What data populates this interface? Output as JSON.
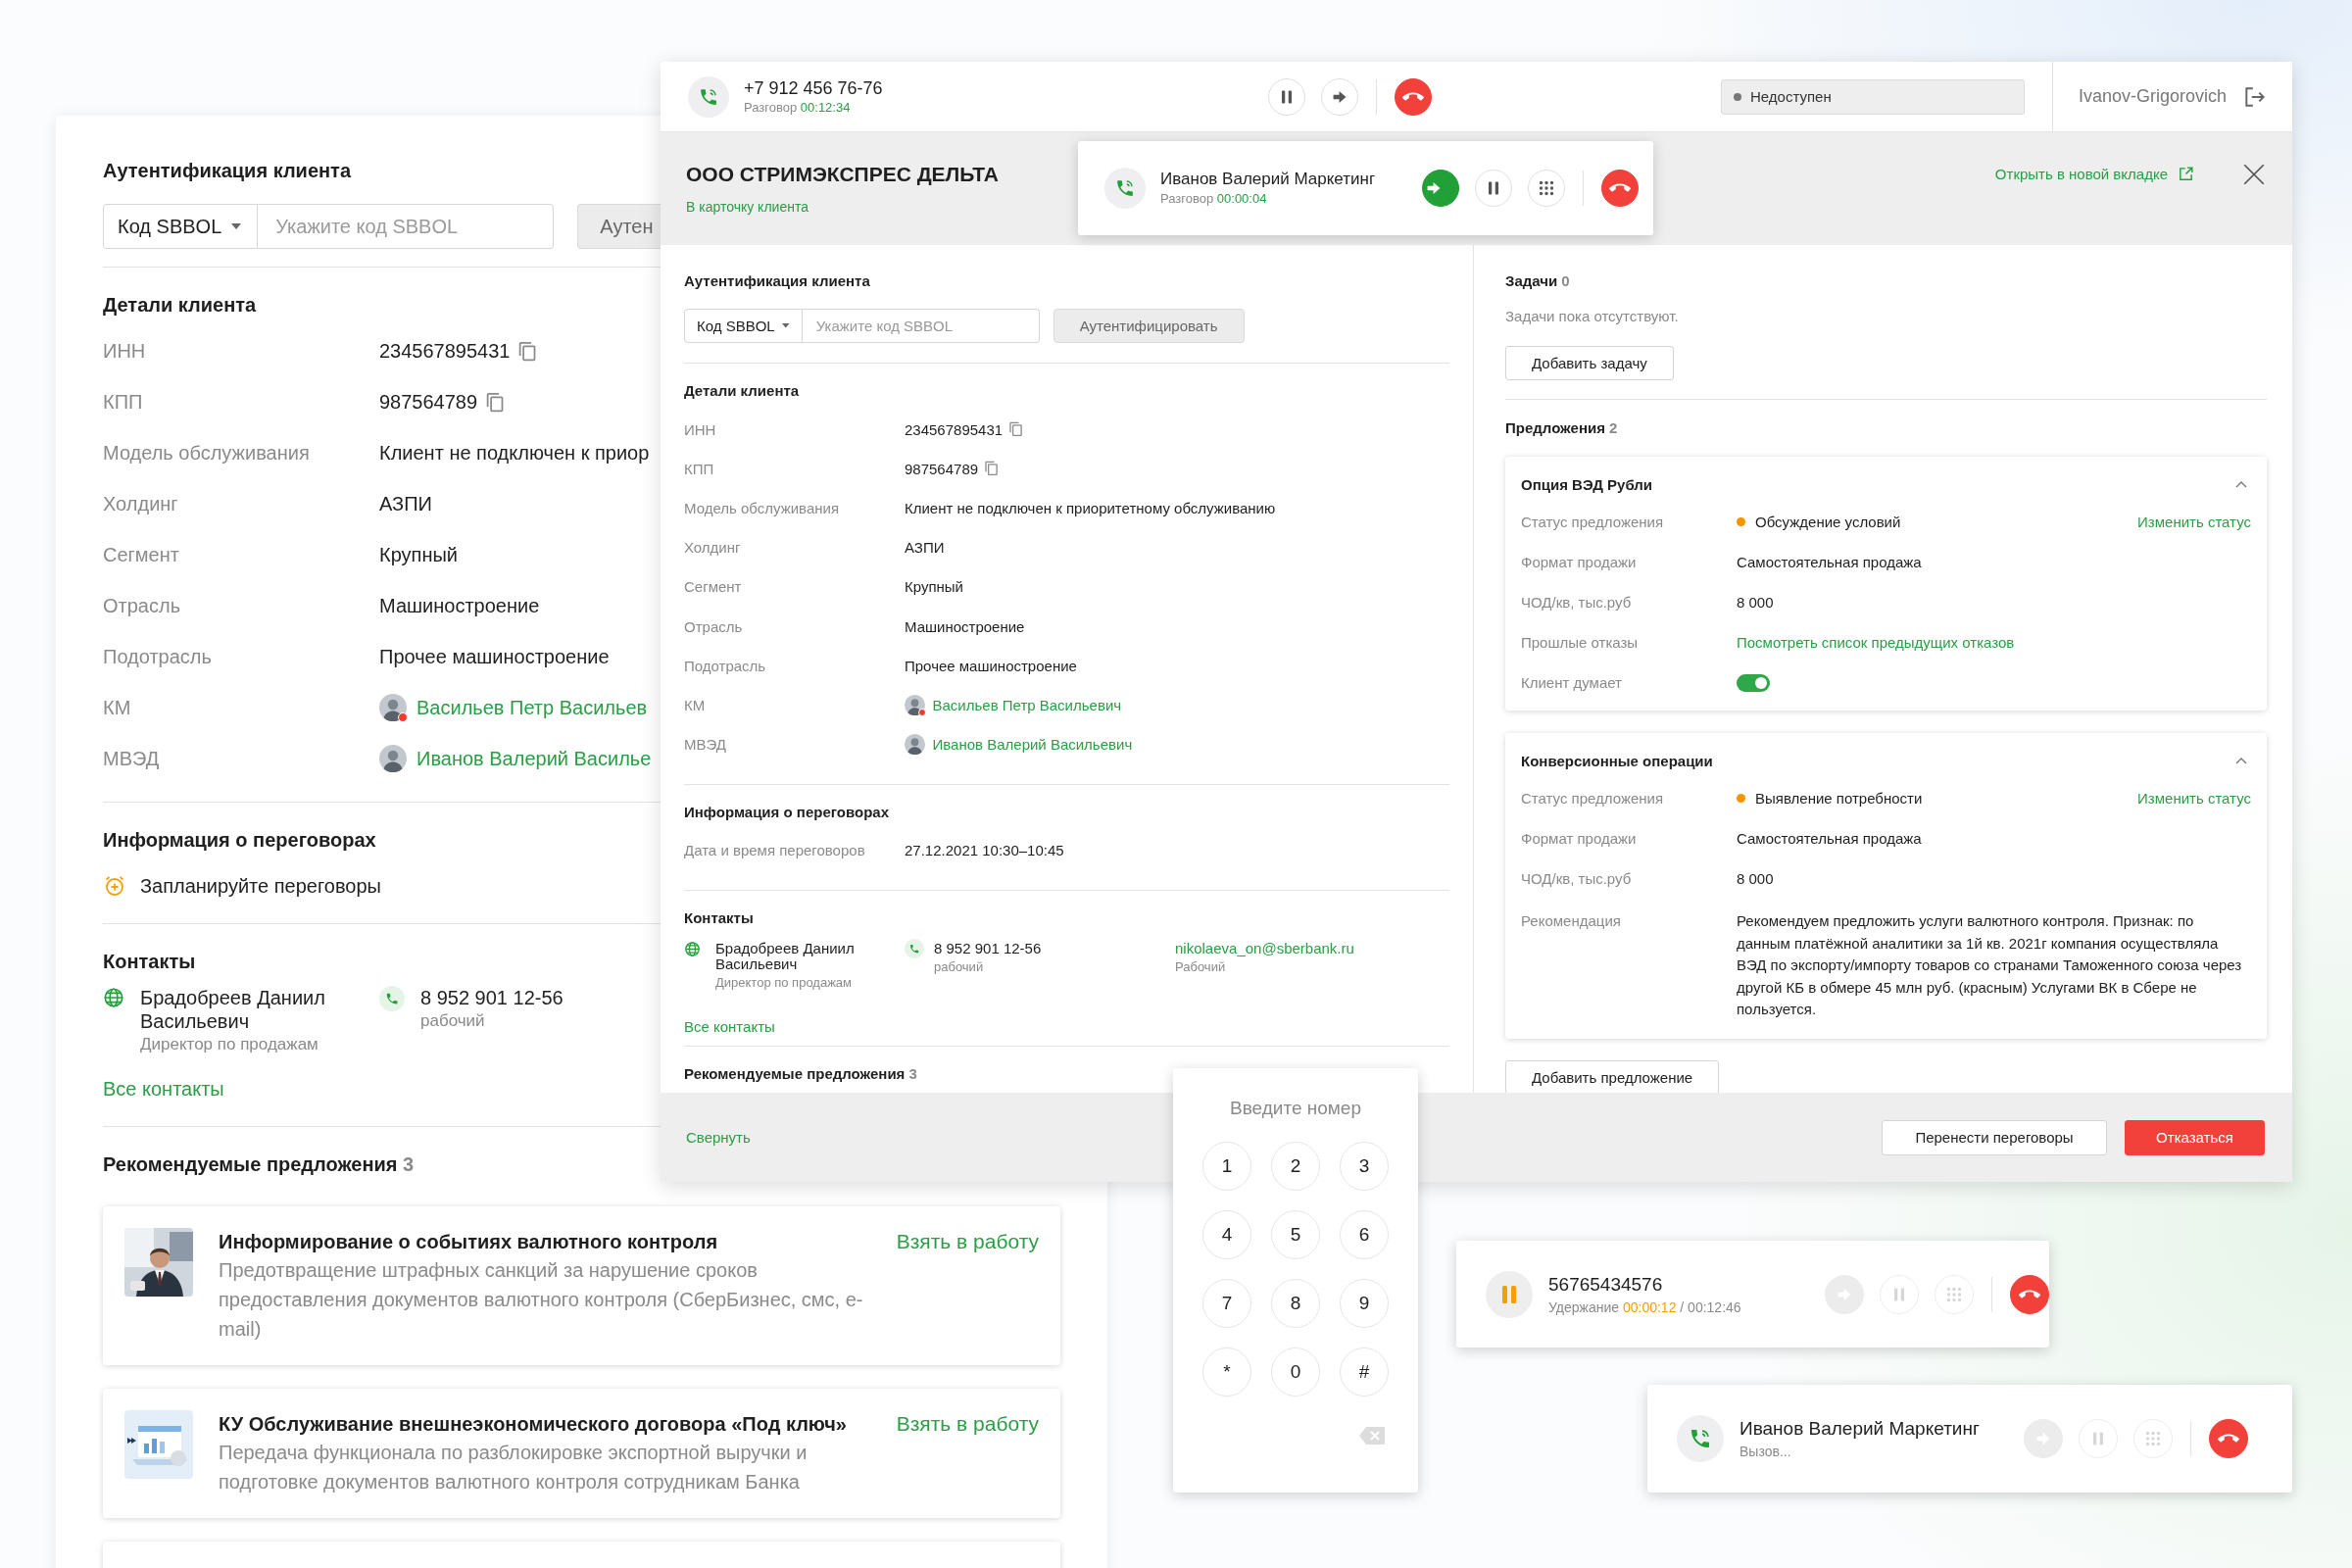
{
  "background_card": {
    "auth": {
      "title": "Аутентификация клиента",
      "select": "Код SBBOL",
      "placeholder": "Укажите код SBBOL",
      "button": "Аутен"
    },
    "details": {
      "title": "Детали клиента",
      "rows": [
        {
          "label": "ИНН",
          "value": "234567895431",
          "kind": "copy"
        },
        {
          "label": "КПП",
          "value": "987564789",
          "kind": "copy"
        },
        {
          "label": "Модель обслуживания",
          "value": "Клиент не подключен к приор",
          "kind": "text"
        },
        {
          "label": "Холдинг",
          "value": "АЗПИ",
          "kind": "text"
        },
        {
          "label": "Сегмент",
          "value": "Крупный",
          "kind": "text"
        },
        {
          "label": "Отрасль",
          "value": "Машиностроение",
          "kind": "text"
        },
        {
          "label": "Подотрасль",
          "value": "Прочее машиностроение",
          "kind": "text"
        },
        {
          "label": "КМ",
          "value": "Васильев Петр Васильев",
          "kind": "person",
          "unavailable": true
        },
        {
          "label": "МВЭД",
          "value": "Иванов Валерий Василье",
          "kind": "person",
          "unavailable": false
        }
      ]
    },
    "negotiations": {
      "title": "Информация о переговорах",
      "schedule": "Запланируйте переговоры"
    },
    "contacts": {
      "title": "Контакты",
      "items": [
        {
          "name": "Брадобреев Даниил Васильевич",
          "role": "Директор по продажам",
          "phone": "8 952 901 12-56",
          "phone_type": "рабочий"
        }
      ],
      "all_link": "Все контакты"
    },
    "offers": {
      "title": "Рекомендуемые предложения",
      "count": "3",
      "items": [
        {
          "kind": "picture",
          "title": "Информирование о событиях валютного контроля",
          "description": "Предотвращение штрафных санкций за нарушение сроков предоставления документов валютного контроля (СберБизнес, смс, e-mail)",
          "action": "Взять в работу"
        },
        {
          "kind": "picture",
          "title": "КУ Обслуживание внешнеэкономического договора «Под ключ»",
          "description": "Передача функционала по разблокировке экспортной выручки и подготовке документов валютного контроля сотрудникам Банка",
          "action": "Взять в работу"
        }
      ]
    }
  },
  "call_window": {
    "top_bar": {
      "on_hold": false,
      "number": "+7 912 456 76-76",
      "status_label": "Разговор",
      "timer": "00:12:34",
      "controls": [
        {
          "kind": "pause",
          "disabled": false
        },
        {
          "kind": "transfer",
          "highlighted": false,
          "disabled": false
        },
        {
          "kind": "hangup",
          "disabled": false
        }
      ],
      "presence": "Недоступен",
      "user": "Ivanov-Grigorovich"
    },
    "header": {
      "company": "ООО СТРИМЭКСПРЕС ДЕЛЬТА",
      "card_link": "В карточку клиента",
      "open_link": "Открыть в новой вкладке"
    },
    "client": {
      "auth": {
        "title": "Аутентификация клиента",
        "select": "Код SBBOL",
        "placeholder": "Укажите код SBBOL",
        "button": "Аутентифицировать"
      },
      "details": {
        "title": "Детали клиента",
        "rows": [
          {
            "label": "ИНН",
            "value": "234567895431",
            "kind": "copy"
          },
          {
            "label": "КПП",
            "value": "987564789",
            "kind": "copy"
          },
          {
            "label": "Модель обслуживания",
            "value": "Клиент не подключен к приоритетному обслуживанию",
            "kind": "text"
          },
          {
            "label": "Холдинг",
            "value": "АЗПИ",
            "kind": "text"
          },
          {
            "label": "Сегмент",
            "value": "Крупный",
            "kind": "text"
          },
          {
            "label": "Отрасль",
            "value": "Машиностроение",
            "kind": "text"
          },
          {
            "label": "Подотрасль",
            "value": "Прочее машиностроение",
            "kind": "text"
          },
          {
            "label": "КМ",
            "value": "Васильев Петр Васильевич",
            "kind": "person",
            "unavailable": true
          },
          {
            "label": "МВЭД",
            "value": "Иванов Валерий Васильевич",
            "kind": "person",
            "unavailable": false
          }
        ]
      },
      "negotiations": {
        "title": "Информация о переговорах",
        "rows": [
          {
            "label": "Дата и время переговоров",
            "value": "27.12.2021 10:30–10:45",
            "kind": "text"
          }
        ]
      },
      "contacts": {
        "title": "Контакты",
        "items": [
          {
            "name": "Брадобреев Даниил Васильевич",
            "role": "Директор по продажам",
            "phone": "8 952 901 12-56",
            "phone_type": "рабочий",
            "email": "nikolaeva_on@sberbank.ru",
            "email_type": "Рабочий"
          }
        ],
        "all_link": "Все контакты"
      },
      "recommended": {
        "title": "Рекомендуемые предложения",
        "count": "3"
      }
    },
    "side": {
      "tasks": {
        "title": "Задачи",
        "count": "0",
        "empty": "Задачи пока отсутствуют.",
        "button": "Добавить задачу"
      },
      "offers": {
        "title": "Предложения",
        "count": "2",
        "items": [
          {
            "title": "Опция ВЭД Рубли",
            "expanded": true,
            "rows": [
              {
                "label": "Статус предложения",
                "value": "Обсуждение условий",
                "kind": "status",
                "color": "#f59300",
                "action": "Изменить статус"
              },
              {
                "label": "Формат продажи",
                "value": "Самостоятельная продажа",
                "kind": "text"
              },
              {
                "label": "ЧОД/кв, тыс.руб",
                "value": "8 000",
                "kind": "text"
              },
              {
                "label": "Прошлые отказы",
                "value": "Посмотреть список предыдущих отказов",
                "kind": "link"
              },
              {
                "label": "Клиент думает",
                "kind": "toggle",
                "on": true
              }
            ]
          },
          {
            "title": "Конверсионные операции",
            "expanded": true,
            "rows": [
              {
                "label": "Статус предложения",
                "value": "Выявление потребности",
                "kind": "status",
                "color": "#f59300",
                "action": "Изменить статус"
              },
              {
                "label": "Формат продажи",
                "value": "Самостоятельная продажа",
                "kind": "text"
              },
              {
                "label": "ЧОД/кв, тыс.руб",
                "value": "8 000",
                "kind": "text"
              },
              {
                "label": "Рекомендация",
                "value": "Рекомендуем предложить услуги валютного контроля. Признак: по данным платёжной аналитики за 1й кв. 2021г компания осуществляла ВЭД по экспорту/импорту товаров со странами Таможенного союза через другой КБ в обмере 45 млн руб. (красным) Услугами ВК в Сбере не пользуется.",
                "kind": "text"
              }
            ]
          }
        ],
        "add_button": "Добавить предложение"
      }
    },
    "footer": {
      "collapse": "Свернуть",
      "buttons": [
        {
          "label": "Перенести переговоры",
          "kind": "secondary"
        },
        {
          "label": "Отказаться",
          "kind": "danger"
        }
      ]
    }
  },
  "incoming_call": {
    "on_hold": false,
    "name": "Иванов Валерий Маркетинг",
    "status_label": "Разговор",
    "timer": "00:00:04",
    "controls": [
      {
        "kind": "transfer",
        "highlighted": true,
        "disabled": false
      },
      {
        "kind": "pause",
        "disabled": false
      },
      {
        "kind": "keypad",
        "disabled": false
      },
      {
        "kind": "hangup",
        "disabled": false
      }
    ]
  },
  "dialpad": {
    "title": "Введите номер",
    "keys": [
      "1",
      "2",
      "3",
      "4",
      "5",
      "6",
      "7",
      "8",
      "9",
      "*",
      "0",
      "#"
    ]
  },
  "held_call": {
    "on_hold": true,
    "number": "56765434576",
    "status_label": "Удержание",
    "timer": "00:00:12",
    "total": "/ 00:12:46",
    "controls": [
      {
        "kind": "transfer",
        "disabled": true
      },
      {
        "kind": "pause",
        "disabled": true
      },
      {
        "kind": "keypad",
        "disabled": true
      },
      {
        "kind": "hangup",
        "disabled": false
      }
    ]
  },
  "outgoing_call": {
    "on_hold": false,
    "name": "Иванов Валерий Маркетинг",
    "status_label": "Вызов...",
    "controls": [
      {
        "kind": "transfer",
        "disabled": true
      },
      {
        "kind": "pause",
        "disabled": true
      },
      {
        "kind": "keypad",
        "disabled": true
      },
      {
        "kind": "hangup",
        "disabled": false
      }
    ]
  }
}
